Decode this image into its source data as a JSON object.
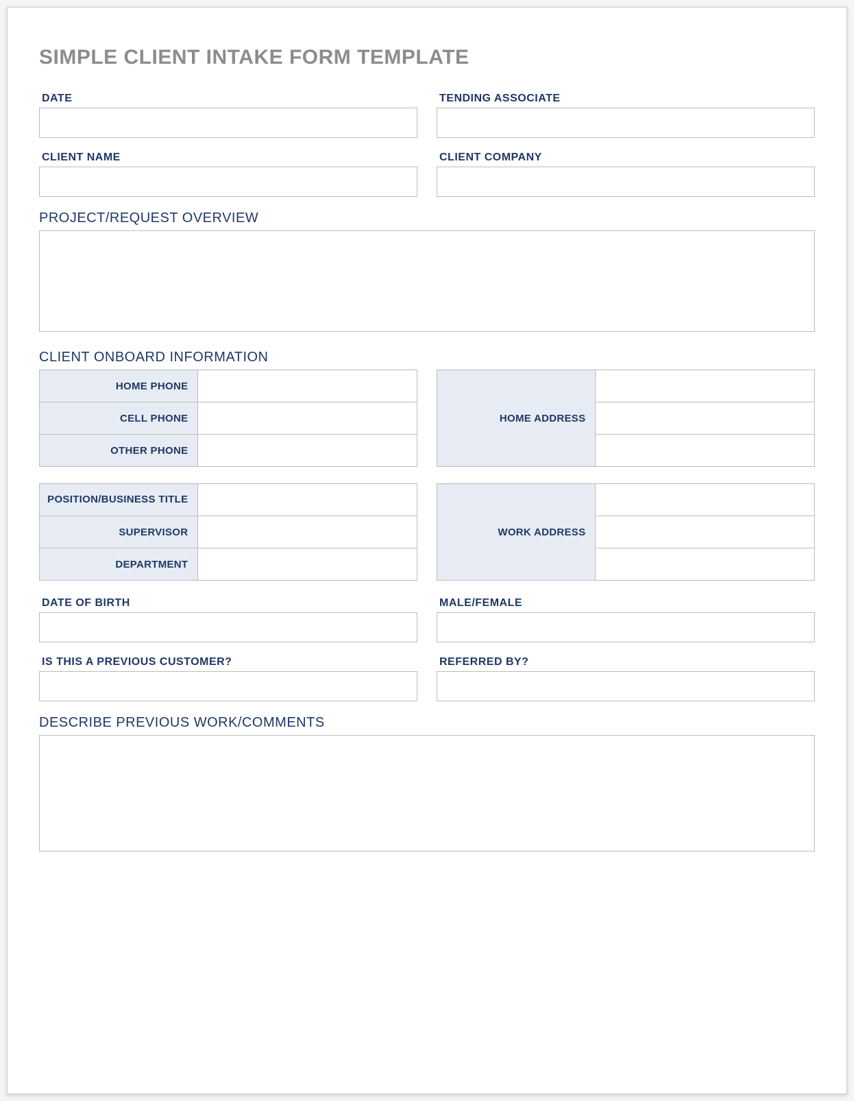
{
  "title": "SIMPLE CLIENT INTAKE FORM TEMPLATE",
  "fields": {
    "date": {
      "label": "DATE",
      "value": ""
    },
    "tending_associate": {
      "label": "TENDING ASSOCIATE",
      "value": ""
    },
    "client_name": {
      "label": "CLIENT NAME",
      "value": ""
    },
    "client_company": {
      "label": "CLIENT COMPANY",
      "value": ""
    },
    "date_of_birth": {
      "label": "DATE OF BIRTH",
      "value": ""
    },
    "male_female": {
      "label": "MALE/FEMALE",
      "value": ""
    },
    "previous_customer": {
      "label": "IS THIS A PREVIOUS CUSTOMER?",
      "value": ""
    },
    "referred_by": {
      "label": "REFERRED BY?",
      "value": ""
    }
  },
  "sections": {
    "project_overview": {
      "label": "PROJECT/REQUEST OVERVIEW",
      "value": ""
    },
    "onboard_info": {
      "label": "CLIENT ONBOARD INFORMATION"
    },
    "describe_previous": {
      "label": "DESCRIBE PREVIOUS WORK/COMMENTS",
      "value": ""
    }
  },
  "onboard": {
    "home_phone": {
      "label": "HOME PHONE",
      "value": ""
    },
    "cell_phone": {
      "label": "CELL PHONE",
      "value": ""
    },
    "other_phone": {
      "label": "OTHER PHONE",
      "value": ""
    },
    "home_address": {
      "label": "HOME ADDRESS",
      "line1": "",
      "line2": "",
      "line3": ""
    },
    "position_title": {
      "label": "POSITION/BUSINESS TITLE",
      "value": ""
    },
    "supervisor": {
      "label": "SUPERVISOR",
      "value": ""
    },
    "department": {
      "label": "DEPARTMENT",
      "value": ""
    },
    "work_address": {
      "label": "WORK ADDRESS",
      "line1": "",
      "line2": "",
      "line3": ""
    }
  }
}
